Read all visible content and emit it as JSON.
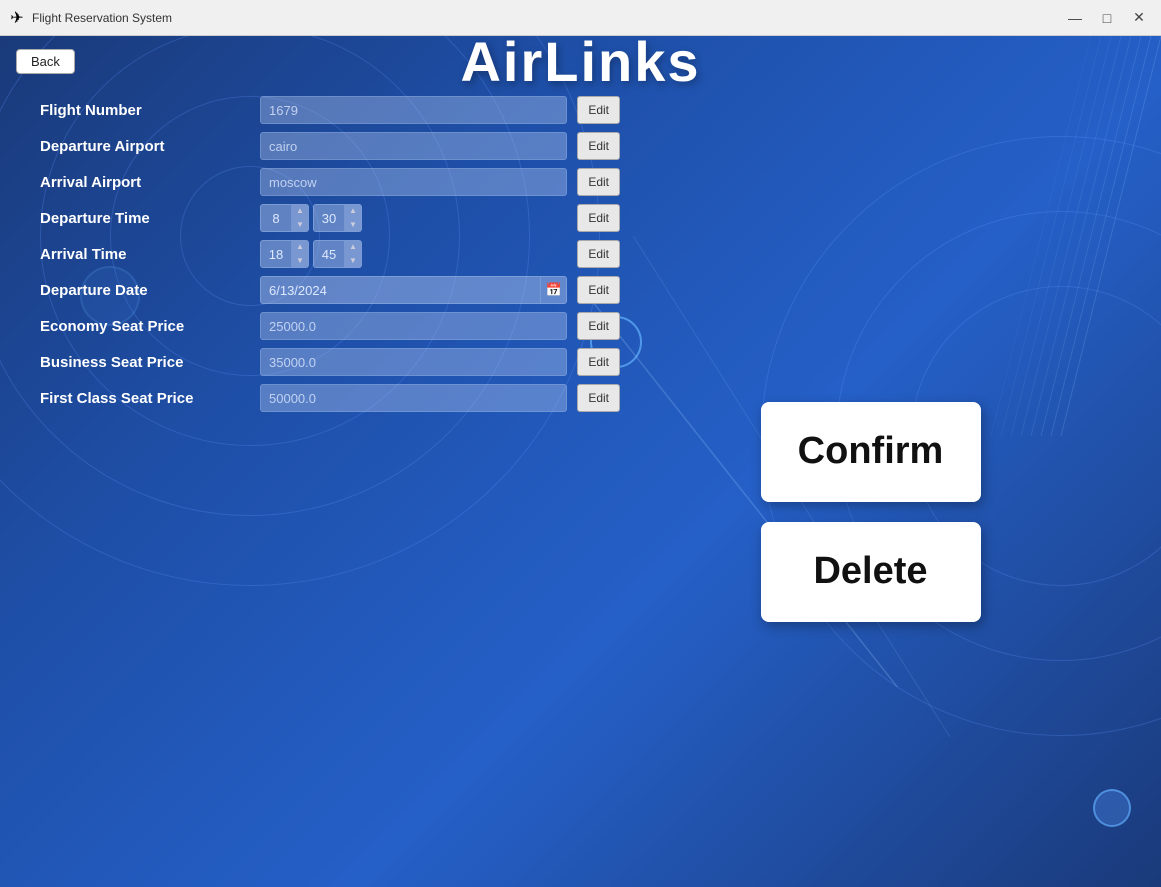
{
  "titleBar": {
    "icon": "✈",
    "title": "Flight Reservation System",
    "minimize": "—",
    "maximize": "□",
    "close": "✕"
  },
  "app": {
    "title": "AirLinks",
    "backButton": "Back"
  },
  "form": {
    "fields": [
      {
        "id": "flight-number",
        "label": "Flight Number",
        "value": "1679",
        "type": "text",
        "editLabel": "Edit"
      },
      {
        "id": "departure-airport",
        "label": "Departure Airport",
        "value": "cairo",
        "type": "text",
        "editLabel": "Edit"
      },
      {
        "id": "arrival-airport",
        "label": "Arrival Airport",
        "value": "moscow",
        "type": "text",
        "editLabel": "Edit"
      },
      {
        "id": "departure-time",
        "label": "Departure Time",
        "type": "time",
        "hour": "8",
        "minute": "30",
        "editLabel": "Edit"
      },
      {
        "id": "arrival-time",
        "label": "Arrival Time",
        "type": "time",
        "hour": "18",
        "minute": "45",
        "editLabel": "Edit"
      },
      {
        "id": "departure-date",
        "label": "Departure Date",
        "value": "6/13/2024",
        "type": "date",
        "editLabel": "Edit"
      },
      {
        "id": "economy-seat-price",
        "label": "Economy Seat Price",
        "value": "25000.0",
        "type": "text",
        "editLabel": "Edit"
      },
      {
        "id": "business-seat-price",
        "label": "Business Seat Price",
        "value": "35000.0",
        "type": "text",
        "editLabel": "Edit"
      },
      {
        "id": "first-class-seat-price",
        "label": "First Class Seat Price",
        "value": "50000.0",
        "type": "text",
        "editLabel": "Edit"
      }
    ]
  },
  "actions": {
    "confirm": "Confirm",
    "delete": "Delete"
  }
}
